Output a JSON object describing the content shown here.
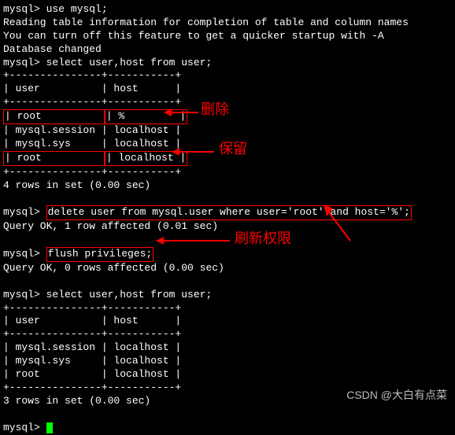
{
  "lines": {
    "l1": "mysql> use mysql;",
    "l2": "Reading table information for completion of table and column names",
    "l3": "You can turn off this feature to get a quicker startup with -A",
    "l4": "",
    "l5": "Database changed",
    "l6": "mysql> select user,host from user;",
    "sep1": "+---------------+-----------+",
    "hdr1": "| user          | host      |",
    "row1_user": "| root          ",
    "row1_host": "| %         |",
    "row2": "| mysql.session | localhost |",
    "row3": "| mysql.sys     | localhost |",
    "row4_user": "| root          ",
    "row4_host": "| localhost |",
    "sum1": "4 rows in set (0.00 sec)",
    "del_prompt": "mysql> ",
    "del_cmd": "delete user from mysql.user where user='root' and host='%';",
    "del_res": "Query OK, 1 row affected (0.01 sec)",
    "flush_prompt": "mysql> ",
    "flush_cmd": "flush privileges;",
    "flush_res": "Query OK, 0 rows affected (0.00 sec)",
    "sel2": "mysql> select user,host from user;",
    "r2_1": "| mysql.session | localhost |",
    "r2_2": "| mysql.sys     | localhost |",
    "r2_3": "| root          | localhost |",
    "sum2": "3 rows in set (0.00 sec)",
    "final_prompt": "mysql> "
  },
  "annotations": {
    "delete_label": "删除",
    "keep_label": "保留",
    "refresh_label": "刷新权限"
  },
  "watermark": "CSDN @大白有点菜"
}
